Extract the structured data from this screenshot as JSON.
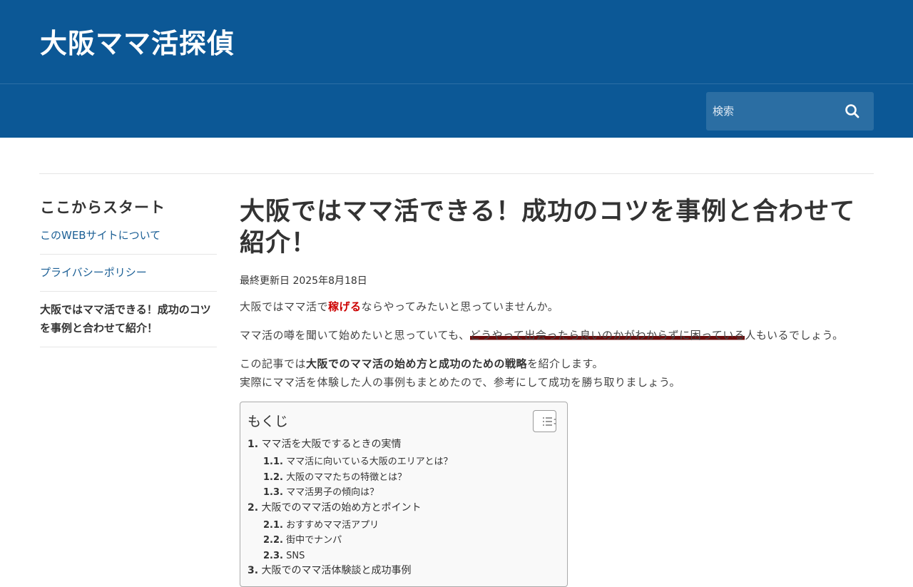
{
  "site": {
    "title": "大阪ママ活探偵"
  },
  "search": {
    "placeholder": "検索"
  },
  "sidebar": {
    "heading": "ここからスタート",
    "items": [
      {
        "label": "このWEBサイトについて"
      },
      {
        "label": "プライバシーポリシー"
      },
      {
        "label": "大阪ではママ活できる！成功のコツを事例と合わせて紹介！"
      }
    ]
  },
  "article": {
    "title": "大阪ではママ活できる！成功のコツを事例と合わせて紹介！",
    "updated": "最終更新日 2025年8月18日",
    "p1": {
      "a": "大阪ではママ活で",
      "b": "稼げる",
      "c": "ならやってみたいと思っていませんか。"
    },
    "p2": {
      "a": "ママ活の噂を聞いて始めたいと思っていても、",
      "b": "どうやって出会ったら良いのかがわからずに困っている",
      "c": "人もいるでしょう。"
    },
    "p3": {
      "a": "この記事では",
      "b": "大阪でのママ活の始め方と成功のための戦略",
      "c": "を紹介します。"
    },
    "p4": "実際にママ活を体験した人の事例もまとめたので、参考にして成功を勝ち取りましょう。"
  },
  "toc": {
    "title": "もくじ",
    "items": [
      {
        "num": "1.",
        "label": "ママ活を大阪でするときの実情"
      },
      {
        "num": "1.1.",
        "label": "ママ活に向いている大阪のエリアとは？"
      },
      {
        "num": "1.2.",
        "label": "大阪のママたちの特徴とは？"
      },
      {
        "num": "1.3.",
        "label": "ママ活男子の傾向は？"
      },
      {
        "num": "2.",
        "label": "大阪でのママ活の始め方とポイント"
      },
      {
        "num": "2.1.",
        "label": "おすすめママ活アプリ"
      },
      {
        "num": "2.2.",
        "label": "街中でナンパ"
      },
      {
        "num": "2.3.",
        "label": "SNS"
      },
      {
        "num": "3.",
        "label": "大阪でのママ活体験談と成功事例"
      }
    ]
  },
  "colors": {
    "header": "#0c5896",
    "search_box": "#2b6ea3",
    "link": "#1b5f95",
    "emphasis_red": "#cc0000",
    "marker": "#6b0d0d"
  }
}
